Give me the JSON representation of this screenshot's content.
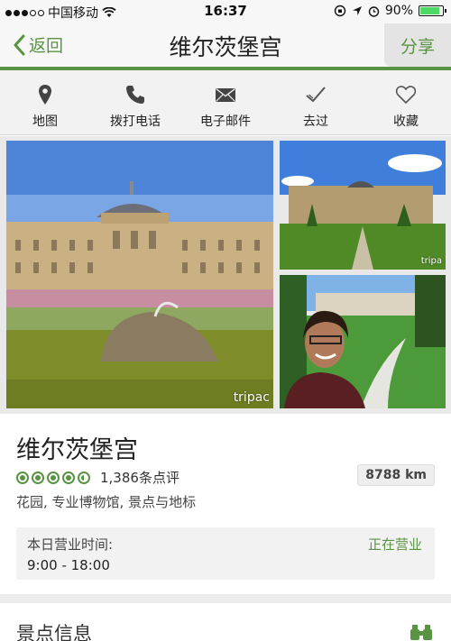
{
  "status_bar": {
    "carrier": "中国移动",
    "time": "16:37",
    "battery": "90%"
  },
  "nav": {
    "back_label": "返回",
    "title": "维尔茨堡宫",
    "share_label": "分享"
  },
  "actions": [
    {
      "label": "地图",
      "icon": "map-pin-icon"
    },
    {
      "label": "拨打电话",
      "icon": "phone-icon"
    },
    {
      "label": "电子邮件",
      "icon": "mail-icon"
    },
    {
      "label": "去过",
      "icon": "check-icon"
    },
    {
      "label": "收藏",
      "icon": "heart-icon"
    }
  ],
  "photos": {
    "watermark_main": "tripac",
    "watermark_small": "tripa"
  },
  "place": {
    "title": "维尔茨堡宫",
    "rating": 4.5,
    "review_count": "1,386条点评",
    "distance": "8788 km",
    "categories": "花园, 专业博物馆, 景点与地标"
  },
  "hours": {
    "label": "本日营业时间:",
    "status": "正在营业",
    "time": "9:00 - 18:00"
  },
  "section": {
    "title": "景点信息",
    "icon": "binoculars-icon"
  },
  "colors": {
    "accent": "#589442",
    "background": "#f7f7f7"
  }
}
